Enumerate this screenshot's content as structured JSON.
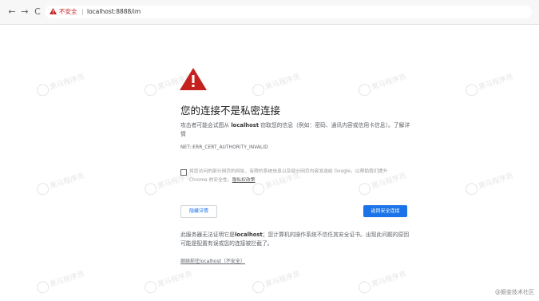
{
  "browser": {
    "back_icon": "←",
    "forward_icon": "→",
    "reload_icon": "C",
    "security_label": "不安全",
    "separator": "|",
    "url": "localhost:8888/im"
  },
  "error": {
    "title": "您的连接不是私密连接",
    "desc_prefix": "攻击者可能会试图从 ",
    "desc_host": "localhost",
    "desc_suffix": " 窃取您的信息（例如：密码、通讯内容或信用卡信息）。了解详情",
    "code": "NET::ERR_CERT_AUTHORITY_INVALID",
    "checkbox_text": "将您访问的部分网页的网址、有限的系统信息以及部分网页内容发送给 Google，以帮助我们提升 Chrome 的安全性。",
    "privacy_link": "隐私权政策",
    "details_button": "隐藏详情",
    "back_button": "返回安全连接",
    "details_prefix": "此服务器无法证明它是",
    "details_host": "localhost",
    "details_suffix": "；您计算机的操作系统不信任其安全证书。出现此问题的原因可能是配置有误或您的连接被拦截了。",
    "proceed_link": "继续前往localhost（不安全）"
  },
  "watermark": {
    "text": "黑马程序员",
    "corner": "@掘金技术社区"
  },
  "colors": {
    "warning_red": "#c5221f",
    "accent_blue": "#1a73e8"
  }
}
